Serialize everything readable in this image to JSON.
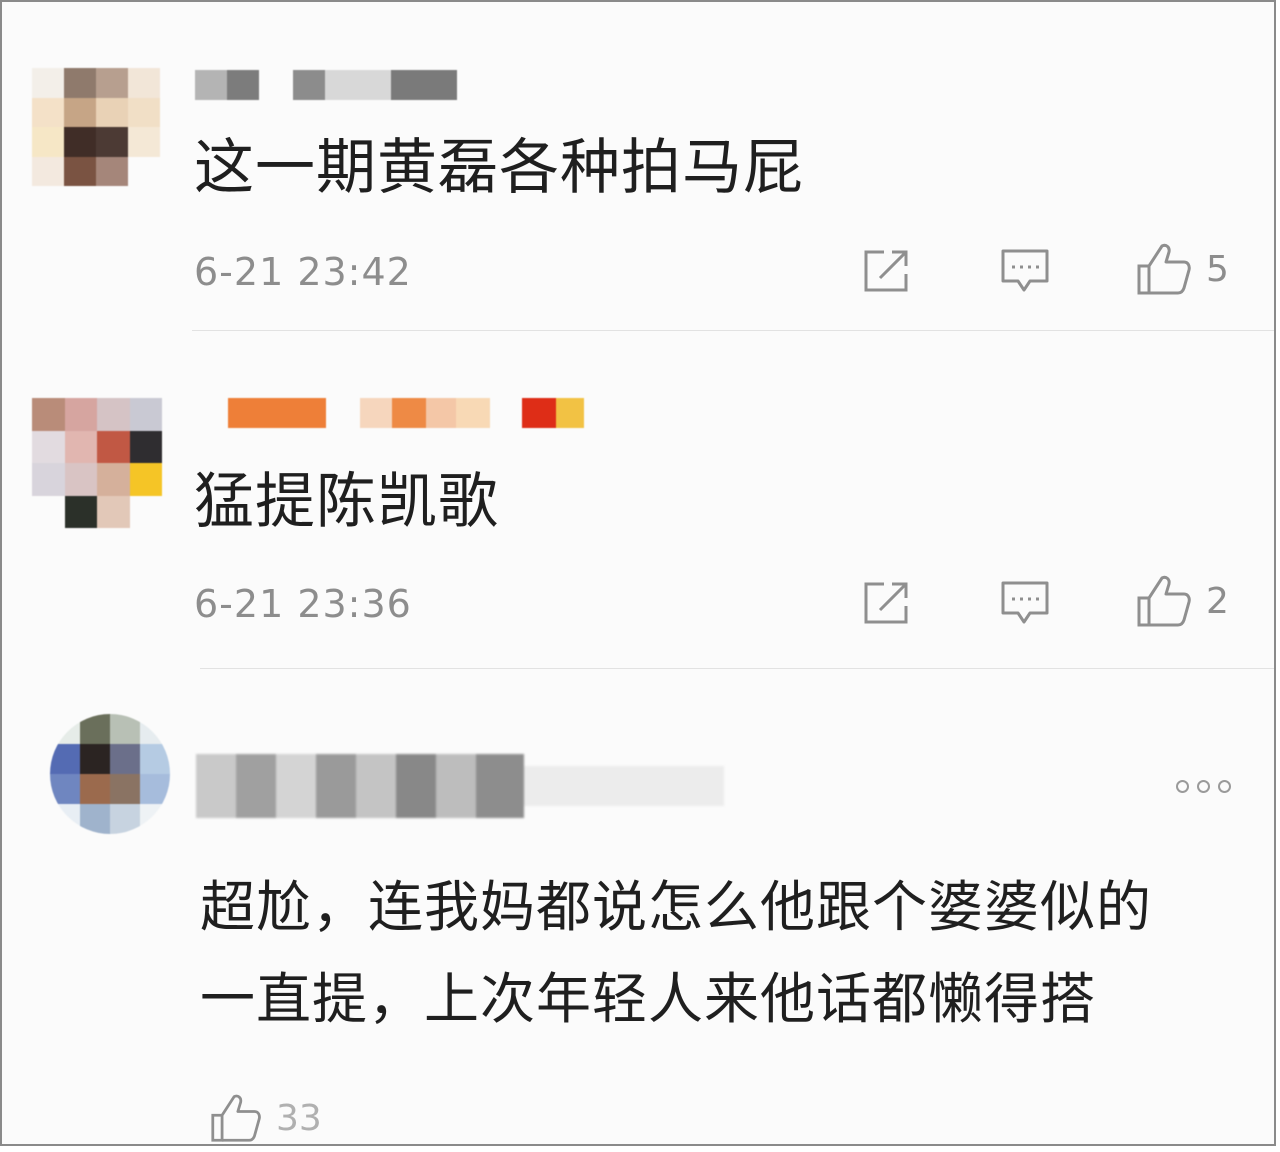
{
  "comments": [
    {
      "text": "这一期黄磊各种拍马屁",
      "time": "6-21 23:42",
      "likes": "5"
    },
    {
      "text": "猛提陈凯歌",
      "time": "6-21 23:36",
      "likes": "2"
    },
    {
      "text_line1": "超尬，连我妈都说怎么他跟个婆婆似的",
      "text_line2": "一直提，上次年轻人来他话都懒得搭",
      "likes": "33"
    }
  ],
  "icons": {
    "share": "share-icon",
    "reply": "comment-icon",
    "like": "thumbs-up-icon",
    "more": "more-options-icon"
  },
  "colors": {
    "text": "#1f1f1f",
    "meta": "#8d8d8d",
    "divider": "#e2e2e2",
    "icon": "#8f8f8f"
  }
}
